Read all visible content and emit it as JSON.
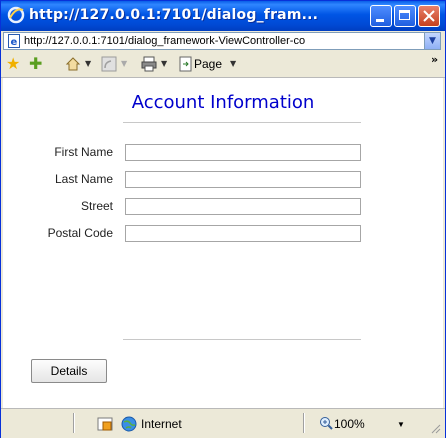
{
  "window": {
    "title": "http://127.0.0.1:7101/dialog_fram...",
    "address": "http://127.0.0.1:7101/dialog_framework-ViewController-co"
  },
  "toolbar": {
    "page_label": "Page",
    "overflow": "»"
  },
  "form": {
    "heading": "Account Information",
    "fields": [
      {
        "label": "First Name",
        "value": ""
      },
      {
        "label": "Last Name",
        "value": ""
      },
      {
        "label": "Street",
        "value": ""
      },
      {
        "label": "Postal Code",
        "value": ""
      }
    ],
    "details_button": "Details"
  },
  "status": {
    "zone": "Internet",
    "zoom": "100%"
  },
  "colors": {
    "heading": "#0000cc",
    "titlebar": "#0055e5"
  },
  "icons": [
    "ie-logo-icon",
    "page-icon",
    "favorites-star-icon",
    "add-favorites-icon",
    "home-icon",
    "feeds-icon",
    "print-icon",
    "page-menu-icon",
    "security-icon",
    "globe-icon",
    "zoom-icon"
  ]
}
